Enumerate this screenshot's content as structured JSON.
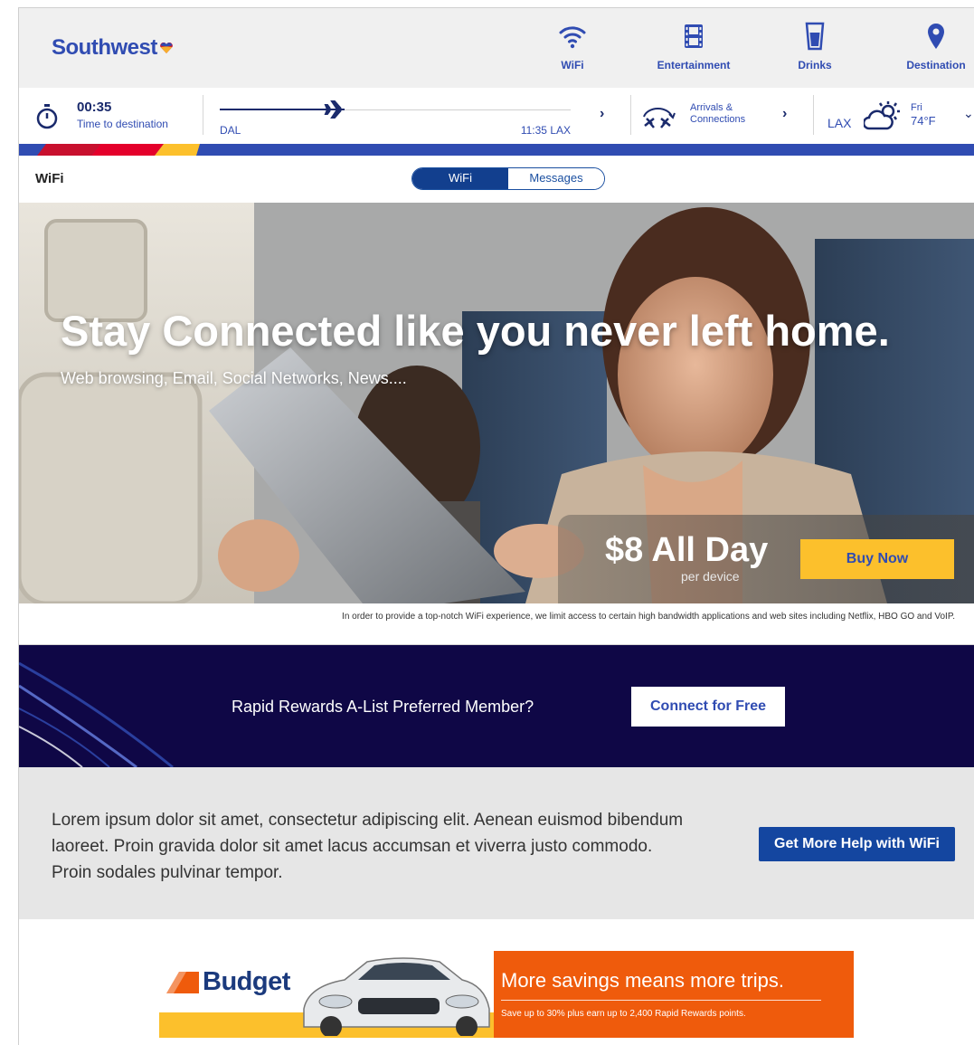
{
  "brand": {
    "name": "Southwest",
    "color": "#304cb2",
    "accent_yellow": "#fcc02c",
    "accent_red": "#c8102e"
  },
  "topnav": {
    "items": [
      {
        "label": "WiFi",
        "icon": "wifi-icon"
      },
      {
        "label": "Entertainment",
        "icon": "film-icon"
      },
      {
        "label": "Drinks",
        "icon": "drink-icon"
      },
      {
        "label": "Destination",
        "icon": "location-pin-icon"
      }
    ]
  },
  "flight": {
    "time_remaining": "00:35",
    "time_label": "Time to destination",
    "origin": "DAL",
    "arrival": "11:35 LAX",
    "progress": 0.33,
    "connections_label": "Arrivals & Connections",
    "dest_city": "LAX",
    "weather_day": "Fri",
    "weather_temp": "74°F",
    "weather_icon": "partly-sunny-icon"
  },
  "subheader": {
    "title": "WiFi",
    "tabs": [
      {
        "label": "WiFi",
        "active": true
      },
      {
        "label": "Messages",
        "active": false
      }
    ]
  },
  "hero": {
    "title": "Stay Connected like you never left home.",
    "subtitle": "Web browsing, Email, Social Networks, News....",
    "price": "$8 All Day",
    "price_note": "per device",
    "cta": "Buy Now",
    "disclaimer": "In order to provide a top-notch WiFi experience, we limit access to certain high bandwidth applications and web sites including Netflix, HBO GO and VoIP."
  },
  "rewards": {
    "question": "Rapid Rewards A-List Preferred Member?",
    "cta": "Connect for Free"
  },
  "help": {
    "text": "Lorem ipsum dolor sit amet, consectetur adipiscing elit. Aenean euismod bibendum laoreet. Proin gravida dolor sit amet lacus accumsan et viverra justo commodo. Proin sodales pulvinar tempor.",
    "cta": "Get More Help with WiFi"
  },
  "ad": {
    "brand": "Budget",
    "headline": "More savings means more trips.",
    "subtext": "Save up to 30% plus earn up to 2,400 Rapid Rewards points."
  }
}
